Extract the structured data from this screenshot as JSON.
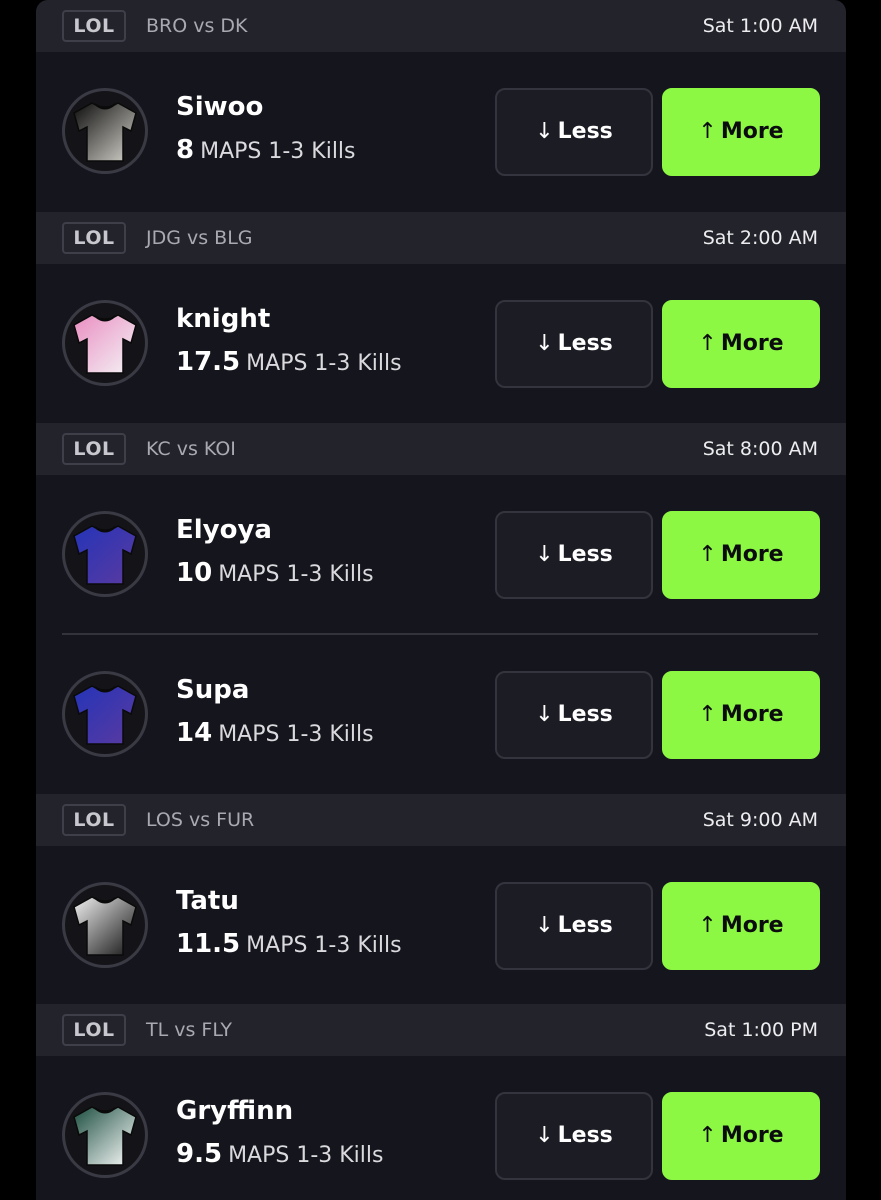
{
  "colors": {
    "background": "#15151d",
    "header_background": "#23232c",
    "more_button": "#8cf843",
    "less_button": "#1c1c24"
  },
  "buttons": {
    "less_label": "Less",
    "more_label": "More",
    "less_icon": "arrow-down-icon",
    "more_icon": "arrow-up-icon"
  },
  "matches": [
    {
      "league": "LOL",
      "matchup": "BRO vs DK",
      "time": "Sat 1:00 AM",
      "players": [
        {
          "name": "Siwoo",
          "line": "8",
          "stat": "MAPS 1-3 Kills",
          "jersey_colors": [
            "#0c0c0c",
            "#d9d7cf"
          ]
        }
      ]
    },
    {
      "league": "LOL",
      "matchup": "JDG vs BLG",
      "time": "Sat 2:00 AM",
      "players": [
        {
          "name": "knight",
          "line": "17.5",
          "stat": "MAPS 1-3 Kills",
          "jersey_colors": [
            "#e98dc1",
            "#f4f4f6"
          ]
        }
      ]
    },
    {
      "league": "LOL",
      "matchup": "KC vs KOI",
      "time": "Sat 8:00 AM",
      "players": [
        {
          "name": "Elyoya",
          "line": "10",
          "stat": "MAPS 1-3 Kills",
          "jersey_colors": [
            "#2434b8",
            "#5b3aa0"
          ]
        },
        {
          "name": "Supa",
          "line": "14",
          "stat": "MAPS 1-3 Kills",
          "jersey_colors": [
            "#2434b8",
            "#5b3aa0"
          ]
        }
      ]
    },
    {
      "league": "LOL",
      "matchup": "LOS vs FUR",
      "time": "Sat 9:00 AM",
      "players": [
        {
          "name": "Tatu",
          "line": "11.5",
          "stat": "MAPS 1-3 Kills",
          "jersey_colors": [
            "#f2f2f2",
            "#111111"
          ]
        }
      ]
    },
    {
      "league": "LOL",
      "matchup": "TL vs FLY",
      "time": "Sat 1:00 PM",
      "players": [
        {
          "name": "Gryffinn",
          "line": "9.5",
          "stat": "MAPS 1-3 Kills",
          "jersey_colors": [
            "#1b4d3f",
            "#ffffff"
          ]
        }
      ]
    }
  ]
}
